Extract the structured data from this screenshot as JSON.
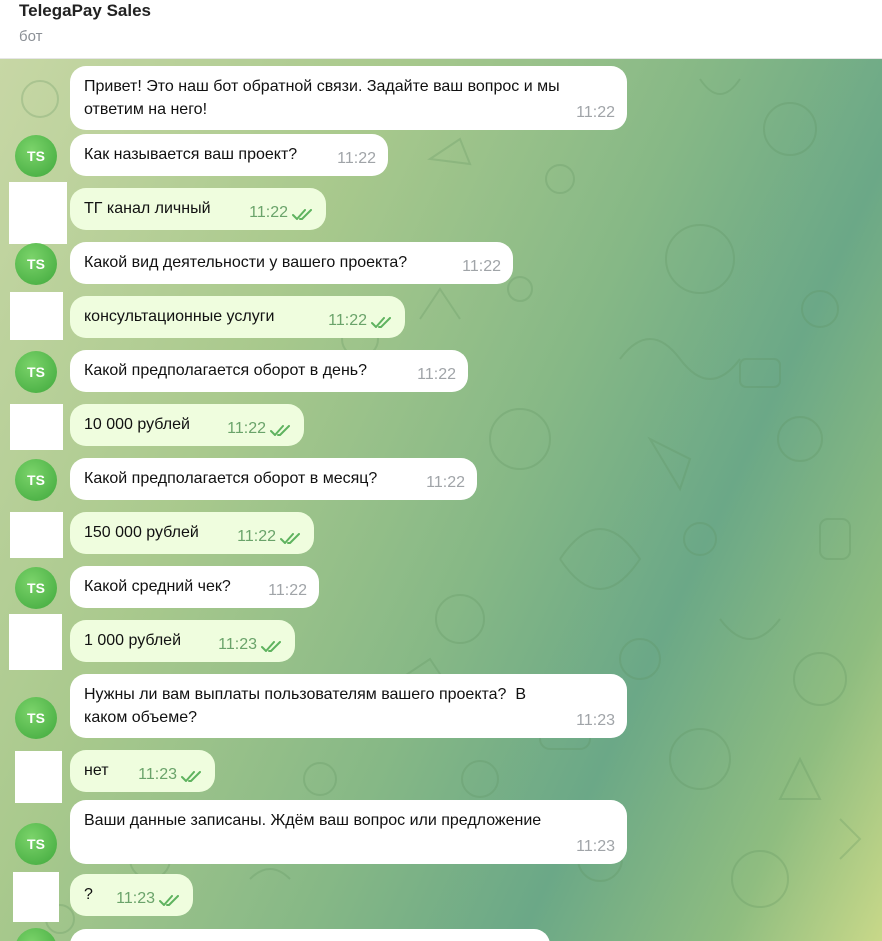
{
  "header": {
    "title": "TelegaPay Sales",
    "subtitle": "бот"
  },
  "bot_avatar_text": "TS",
  "messages": [
    {
      "side": "in",
      "text": "Привет! Это наш бот обратной связи. Задайте ваш вопрос и мы\nответим на него!",
      "time": "11:22"
    },
    {
      "side": "in",
      "text": "Как называется ваш проект?",
      "time": "11:22"
    },
    {
      "side": "out",
      "text": "ТГ канал личный",
      "time": "11:22"
    },
    {
      "side": "in",
      "text": "Какой вид деятельности у вашего проекта?",
      "time": "11:22"
    },
    {
      "side": "out",
      "text": "консультационные услуги",
      "time": "11:22"
    },
    {
      "side": "in",
      "text": "Какой предполагается оборот в день?",
      "time": "11:22"
    },
    {
      "side": "out",
      "text": "10 000 рублей",
      "time": "11:22"
    },
    {
      "side": "in",
      "text": "Какой предполагается оборот в месяц?",
      "time": "11:22"
    },
    {
      "side": "out",
      "text": "150 000 рублей",
      "time": "11:22"
    },
    {
      "side": "in",
      "text": "Какой средний чек?",
      "time": "11:22"
    },
    {
      "side": "out",
      "text": "1 000 рублей",
      "time": "11:23"
    },
    {
      "side": "in",
      "text": "Нужны ли вам выплаты пользователям вашего проекта?  В\nкаком объеме?",
      "time": "11:23"
    },
    {
      "side": "out",
      "text": "нет",
      "time": "11:23"
    },
    {
      "side": "in",
      "text": "Ваши данные записаны. Ждём ваш вопрос или предложение",
      "time": "11:23"
    },
    {
      "side": "out",
      "text": "?",
      "time": "11:23"
    }
  ],
  "colors": {
    "incoming_bubble": "#ffffff",
    "outgoing_bubble": "#effdde",
    "avatar": "#4caf50",
    "read_check": "#5fb35f"
  }
}
